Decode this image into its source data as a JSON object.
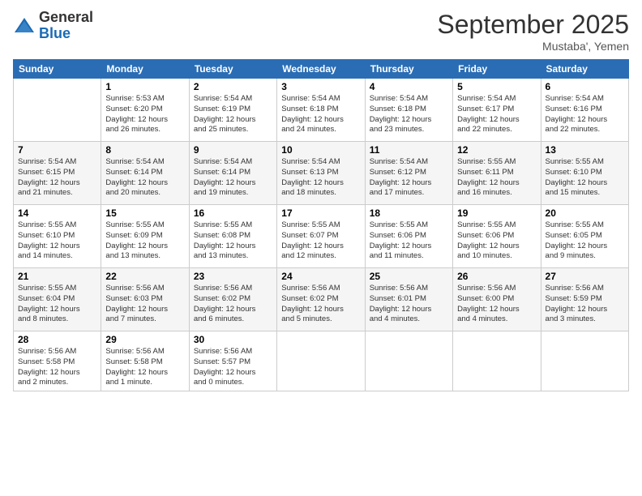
{
  "logo": {
    "general": "General",
    "blue": "Blue"
  },
  "header": {
    "month": "September 2025",
    "location": "Mustaba', Yemen"
  },
  "weekdays": [
    "Sunday",
    "Monday",
    "Tuesday",
    "Wednesday",
    "Thursday",
    "Friday",
    "Saturday"
  ],
  "weeks": [
    [
      {
        "day": "",
        "lines": []
      },
      {
        "day": "1",
        "lines": [
          "Sunrise: 5:53 AM",
          "Sunset: 6:20 PM",
          "Daylight: 12 hours",
          "and 26 minutes."
        ]
      },
      {
        "day": "2",
        "lines": [
          "Sunrise: 5:54 AM",
          "Sunset: 6:19 PM",
          "Daylight: 12 hours",
          "and 25 minutes."
        ]
      },
      {
        "day": "3",
        "lines": [
          "Sunrise: 5:54 AM",
          "Sunset: 6:18 PM",
          "Daylight: 12 hours",
          "and 24 minutes."
        ]
      },
      {
        "day": "4",
        "lines": [
          "Sunrise: 5:54 AM",
          "Sunset: 6:18 PM",
          "Daylight: 12 hours",
          "and 23 minutes."
        ]
      },
      {
        "day": "5",
        "lines": [
          "Sunrise: 5:54 AM",
          "Sunset: 6:17 PM",
          "Daylight: 12 hours",
          "and 22 minutes."
        ]
      },
      {
        "day": "6",
        "lines": [
          "Sunrise: 5:54 AM",
          "Sunset: 6:16 PM",
          "Daylight: 12 hours",
          "and 22 minutes."
        ]
      }
    ],
    [
      {
        "day": "7",
        "lines": [
          "Sunrise: 5:54 AM",
          "Sunset: 6:15 PM",
          "Daylight: 12 hours",
          "and 21 minutes."
        ]
      },
      {
        "day": "8",
        "lines": [
          "Sunrise: 5:54 AM",
          "Sunset: 6:14 PM",
          "Daylight: 12 hours",
          "and 20 minutes."
        ]
      },
      {
        "day": "9",
        "lines": [
          "Sunrise: 5:54 AM",
          "Sunset: 6:14 PM",
          "Daylight: 12 hours",
          "and 19 minutes."
        ]
      },
      {
        "day": "10",
        "lines": [
          "Sunrise: 5:54 AM",
          "Sunset: 6:13 PM",
          "Daylight: 12 hours",
          "and 18 minutes."
        ]
      },
      {
        "day": "11",
        "lines": [
          "Sunrise: 5:54 AM",
          "Sunset: 6:12 PM",
          "Daylight: 12 hours",
          "and 17 minutes."
        ]
      },
      {
        "day": "12",
        "lines": [
          "Sunrise: 5:55 AM",
          "Sunset: 6:11 PM",
          "Daylight: 12 hours",
          "and 16 minutes."
        ]
      },
      {
        "day": "13",
        "lines": [
          "Sunrise: 5:55 AM",
          "Sunset: 6:10 PM",
          "Daylight: 12 hours",
          "and 15 minutes."
        ]
      }
    ],
    [
      {
        "day": "14",
        "lines": [
          "Sunrise: 5:55 AM",
          "Sunset: 6:10 PM",
          "Daylight: 12 hours",
          "and 14 minutes."
        ]
      },
      {
        "day": "15",
        "lines": [
          "Sunrise: 5:55 AM",
          "Sunset: 6:09 PM",
          "Daylight: 12 hours",
          "and 13 minutes."
        ]
      },
      {
        "day": "16",
        "lines": [
          "Sunrise: 5:55 AM",
          "Sunset: 6:08 PM",
          "Daylight: 12 hours",
          "and 13 minutes."
        ]
      },
      {
        "day": "17",
        "lines": [
          "Sunrise: 5:55 AM",
          "Sunset: 6:07 PM",
          "Daylight: 12 hours",
          "and 12 minutes."
        ]
      },
      {
        "day": "18",
        "lines": [
          "Sunrise: 5:55 AM",
          "Sunset: 6:06 PM",
          "Daylight: 12 hours",
          "and 11 minutes."
        ]
      },
      {
        "day": "19",
        "lines": [
          "Sunrise: 5:55 AM",
          "Sunset: 6:06 PM",
          "Daylight: 12 hours",
          "and 10 minutes."
        ]
      },
      {
        "day": "20",
        "lines": [
          "Sunrise: 5:55 AM",
          "Sunset: 6:05 PM",
          "Daylight: 12 hours",
          "and 9 minutes."
        ]
      }
    ],
    [
      {
        "day": "21",
        "lines": [
          "Sunrise: 5:55 AM",
          "Sunset: 6:04 PM",
          "Daylight: 12 hours",
          "and 8 minutes."
        ]
      },
      {
        "day": "22",
        "lines": [
          "Sunrise: 5:56 AM",
          "Sunset: 6:03 PM",
          "Daylight: 12 hours",
          "and 7 minutes."
        ]
      },
      {
        "day": "23",
        "lines": [
          "Sunrise: 5:56 AM",
          "Sunset: 6:02 PM",
          "Daylight: 12 hours",
          "and 6 minutes."
        ]
      },
      {
        "day": "24",
        "lines": [
          "Sunrise: 5:56 AM",
          "Sunset: 6:02 PM",
          "Daylight: 12 hours",
          "and 5 minutes."
        ]
      },
      {
        "day": "25",
        "lines": [
          "Sunrise: 5:56 AM",
          "Sunset: 6:01 PM",
          "Daylight: 12 hours",
          "and 4 minutes."
        ]
      },
      {
        "day": "26",
        "lines": [
          "Sunrise: 5:56 AM",
          "Sunset: 6:00 PM",
          "Daylight: 12 hours",
          "and 4 minutes."
        ]
      },
      {
        "day": "27",
        "lines": [
          "Sunrise: 5:56 AM",
          "Sunset: 5:59 PM",
          "Daylight: 12 hours",
          "and 3 minutes."
        ]
      }
    ],
    [
      {
        "day": "28",
        "lines": [
          "Sunrise: 5:56 AM",
          "Sunset: 5:58 PM",
          "Daylight: 12 hours",
          "and 2 minutes."
        ]
      },
      {
        "day": "29",
        "lines": [
          "Sunrise: 5:56 AM",
          "Sunset: 5:58 PM",
          "Daylight: 12 hours",
          "and 1 minute."
        ]
      },
      {
        "day": "30",
        "lines": [
          "Sunrise: 5:56 AM",
          "Sunset: 5:57 PM",
          "Daylight: 12 hours",
          "and 0 minutes."
        ]
      },
      {
        "day": "",
        "lines": []
      },
      {
        "day": "",
        "lines": []
      },
      {
        "day": "",
        "lines": []
      },
      {
        "day": "",
        "lines": []
      }
    ]
  ]
}
